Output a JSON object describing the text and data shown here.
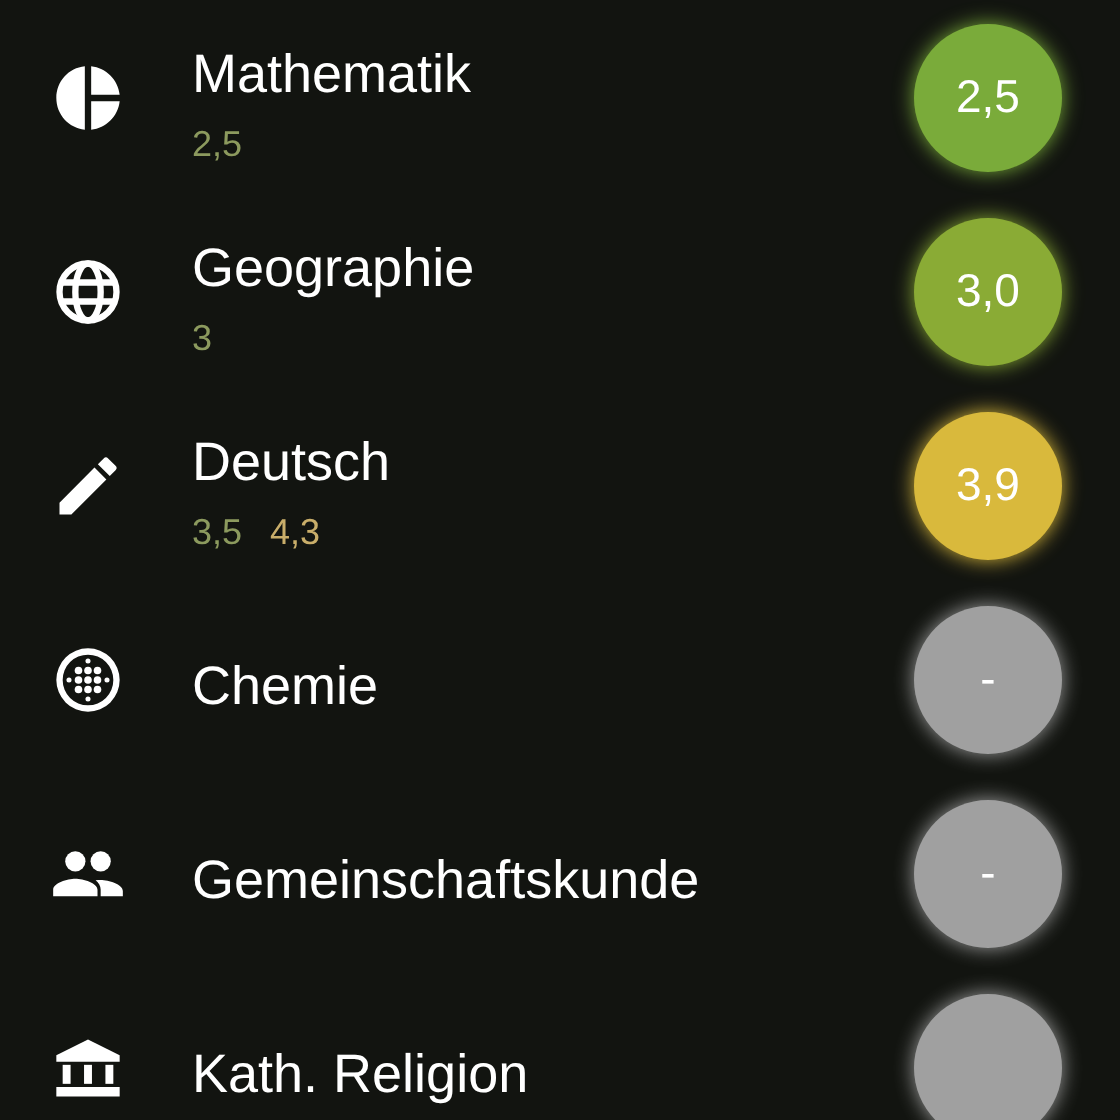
{
  "subjects": [
    {
      "name": "Mathematik",
      "kind": "pie",
      "grades": [
        {
          "text": "2,5",
          "color": "#8c9a5e"
        }
      ],
      "average": "2,5",
      "color": "#7aab3a"
    },
    {
      "name": "Geographie",
      "kind": "globe",
      "grades": [
        {
          "text": "3",
          "color": "#8c9a5e"
        }
      ],
      "average": "3,0",
      "color": "#8aab35"
    },
    {
      "name": "Deutsch",
      "kind": "pencil",
      "grades": [
        {
          "text": "3,5",
          "color": "#8c9a5e"
        },
        {
          "text": "4,3",
          "color": "#c9ae6a"
        }
      ],
      "average": "3,9",
      "color": "#d9b93c"
    },
    {
      "name": "Chemie",
      "kind": "dots",
      "average": "-",
      "color": "#a0a0a0"
    },
    {
      "name": "Gemeinschaftskunde",
      "kind": "people",
      "average": "-",
      "color": "#a0a0a0"
    },
    {
      "name": "Kath. Religion",
      "kind": "bank",
      "color": "#a0a0a0"
    }
  ]
}
